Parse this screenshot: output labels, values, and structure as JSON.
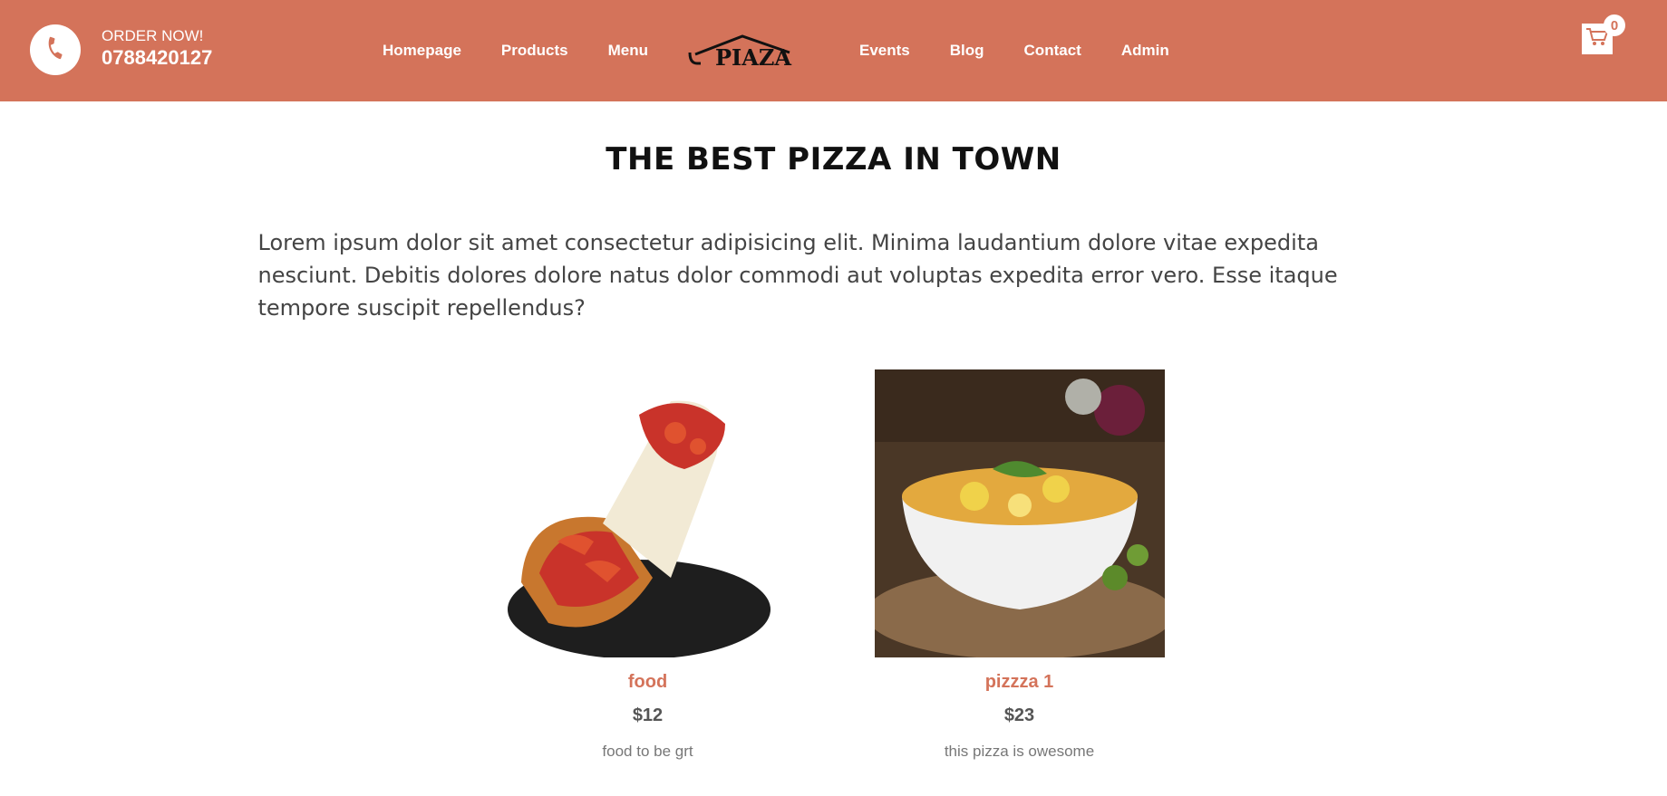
{
  "header": {
    "order_label": "ORDER NOW!",
    "phone_number": "0788420127",
    "nav_left": [
      {
        "label": "Homepage"
      },
      {
        "label": "Products"
      },
      {
        "label": "Menu"
      }
    ],
    "nav_right": [
      {
        "label": "Events"
      },
      {
        "label": "Blog"
      },
      {
        "label": "Contact"
      },
      {
        "label": "Admin"
      }
    ],
    "logo_text": "PIAZA",
    "cart_count": "0",
    "colors": {
      "brand": "#d4735a",
      "white": "#ffffff"
    }
  },
  "main": {
    "title": "THE BEST PIZZA IN TOWN",
    "description": "Lorem ipsum dolor sit amet consectetur adipisicing elit. Minima laudantium dolore vitae expedita nesciunt. Debitis dolores dolore natus dolor commodi aut voluptas expedita error vero. Esse itaque tempore suscipit repellendus?"
  },
  "products": [
    {
      "name": "food",
      "price": "$12",
      "desc": "food to be grt",
      "image": "pizza-slice-photo"
    },
    {
      "name": "pizzza 1",
      "price": "$23",
      "desc": "this pizza is owesome",
      "image": "noodle-bowl-photo"
    }
  ]
}
